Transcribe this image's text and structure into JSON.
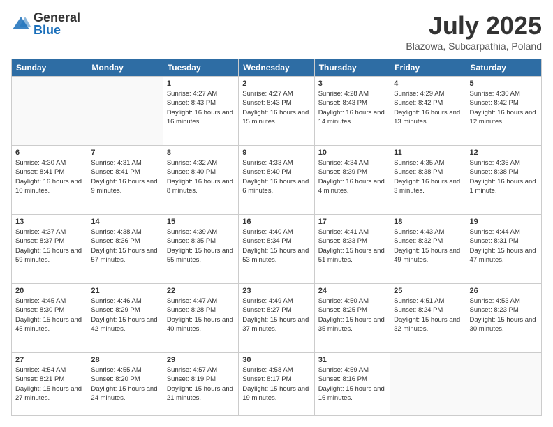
{
  "logo": {
    "general": "General",
    "blue": "Blue"
  },
  "header": {
    "month": "July 2025",
    "location": "Blazowa, Subcarpathia, Poland"
  },
  "weekdays": [
    "Sunday",
    "Monday",
    "Tuesday",
    "Wednesday",
    "Thursday",
    "Friday",
    "Saturday"
  ],
  "weeks": [
    [
      {
        "day": "",
        "sunrise": "",
        "sunset": "",
        "daylight": ""
      },
      {
        "day": "",
        "sunrise": "",
        "sunset": "",
        "daylight": ""
      },
      {
        "day": "1",
        "sunrise": "Sunrise: 4:27 AM",
        "sunset": "Sunset: 8:43 PM",
        "daylight": "Daylight: 16 hours and 16 minutes."
      },
      {
        "day": "2",
        "sunrise": "Sunrise: 4:27 AM",
        "sunset": "Sunset: 8:43 PM",
        "daylight": "Daylight: 16 hours and 15 minutes."
      },
      {
        "day": "3",
        "sunrise": "Sunrise: 4:28 AM",
        "sunset": "Sunset: 8:43 PM",
        "daylight": "Daylight: 16 hours and 14 minutes."
      },
      {
        "day": "4",
        "sunrise": "Sunrise: 4:29 AM",
        "sunset": "Sunset: 8:42 PM",
        "daylight": "Daylight: 16 hours and 13 minutes."
      },
      {
        "day": "5",
        "sunrise": "Sunrise: 4:30 AM",
        "sunset": "Sunset: 8:42 PM",
        "daylight": "Daylight: 16 hours and 12 minutes."
      }
    ],
    [
      {
        "day": "6",
        "sunrise": "Sunrise: 4:30 AM",
        "sunset": "Sunset: 8:41 PM",
        "daylight": "Daylight: 16 hours and 10 minutes."
      },
      {
        "day": "7",
        "sunrise": "Sunrise: 4:31 AM",
        "sunset": "Sunset: 8:41 PM",
        "daylight": "Daylight: 16 hours and 9 minutes."
      },
      {
        "day": "8",
        "sunrise": "Sunrise: 4:32 AM",
        "sunset": "Sunset: 8:40 PM",
        "daylight": "Daylight: 16 hours and 8 minutes."
      },
      {
        "day": "9",
        "sunrise": "Sunrise: 4:33 AM",
        "sunset": "Sunset: 8:40 PM",
        "daylight": "Daylight: 16 hours and 6 minutes."
      },
      {
        "day": "10",
        "sunrise": "Sunrise: 4:34 AM",
        "sunset": "Sunset: 8:39 PM",
        "daylight": "Daylight: 16 hours and 4 minutes."
      },
      {
        "day": "11",
        "sunrise": "Sunrise: 4:35 AM",
        "sunset": "Sunset: 8:38 PM",
        "daylight": "Daylight: 16 hours and 3 minutes."
      },
      {
        "day": "12",
        "sunrise": "Sunrise: 4:36 AM",
        "sunset": "Sunset: 8:38 PM",
        "daylight": "Daylight: 16 hours and 1 minute."
      }
    ],
    [
      {
        "day": "13",
        "sunrise": "Sunrise: 4:37 AM",
        "sunset": "Sunset: 8:37 PM",
        "daylight": "Daylight: 15 hours and 59 minutes."
      },
      {
        "day": "14",
        "sunrise": "Sunrise: 4:38 AM",
        "sunset": "Sunset: 8:36 PM",
        "daylight": "Daylight: 15 hours and 57 minutes."
      },
      {
        "day": "15",
        "sunrise": "Sunrise: 4:39 AM",
        "sunset": "Sunset: 8:35 PM",
        "daylight": "Daylight: 15 hours and 55 minutes."
      },
      {
        "day": "16",
        "sunrise": "Sunrise: 4:40 AM",
        "sunset": "Sunset: 8:34 PM",
        "daylight": "Daylight: 15 hours and 53 minutes."
      },
      {
        "day": "17",
        "sunrise": "Sunrise: 4:41 AM",
        "sunset": "Sunset: 8:33 PM",
        "daylight": "Daylight: 15 hours and 51 minutes."
      },
      {
        "day": "18",
        "sunrise": "Sunrise: 4:43 AM",
        "sunset": "Sunset: 8:32 PM",
        "daylight": "Daylight: 15 hours and 49 minutes."
      },
      {
        "day": "19",
        "sunrise": "Sunrise: 4:44 AM",
        "sunset": "Sunset: 8:31 PM",
        "daylight": "Daylight: 15 hours and 47 minutes."
      }
    ],
    [
      {
        "day": "20",
        "sunrise": "Sunrise: 4:45 AM",
        "sunset": "Sunset: 8:30 PM",
        "daylight": "Daylight: 15 hours and 45 minutes."
      },
      {
        "day": "21",
        "sunrise": "Sunrise: 4:46 AM",
        "sunset": "Sunset: 8:29 PM",
        "daylight": "Daylight: 15 hours and 42 minutes."
      },
      {
        "day": "22",
        "sunrise": "Sunrise: 4:47 AM",
        "sunset": "Sunset: 8:28 PM",
        "daylight": "Daylight: 15 hours and 40 minutes."
      },
      {
        "day": "23",
        "sunrise": "Sunrise: 4:49 AM",
        "sunset": "Sunset: 8:27 PM",
        "daylight": "Daylight: 15 hours and 37 minutes."
      },
      {
        "day": "24",
        "sunrise": "Sunrise: 4:50 AM",
        "sunset": "Sunset: 8:25 PM",
        "daylight": "Daylight: 15 hours and 35 minutes."
      },
      {
        "day": "25",
        "sunrise": "Sunrise: 4:51 AM",
        "sunset": "Sunset: 8:24 PM",
        "daylight": "Daylight: 15 hours and 32 minutes."
      },
      {
        "day": "26",
        "sunrise": "Sunrise: 4:53 AM",
        "sunset": "Sunset: 8:23 PM",
        "daylight": "Daylight: 15 hours and 30 minutes."
      }
    ],
    [
      {
        "day": "27",
        "sunrise": "Sunrise: 4:54 AM",
        "sunset": "Sunset: 8:21 PM",
        "daylight": "Daylight: 15 hours and 27 minutes."
      },
      {
        "day": "28",
        "sunrise": "Sunrise: 4:55 AM",
        "sunset": "Sunset: 8:20 PM",
        "daylight": "Daylight: 15 hours and 24 minutes."
      },
      {
        "day": "29",
        "sunrise": "Sunrise: 4:57 AM",
        "sunset": "Sunset: 8:19 PM",
        "daylight": "Daylight: 15 hours and 21 minutes."
      },
      {
        "day": "30",
        "sunrise": "Sunrise: 4:58 AM",
        "sunset": "Sunset: 8:17 PM",
        "daylight": "Daylight: 15 hours and 19 minutes."
      },
      {
        "day": "31",
        "sunrise": "Sunrise: 4:59 AM",
        "sunset": "Sunset: 8:16 PM",
        "daylight": "Daylight: 15 hours and 16 minutes."
      },
      {
        "day": "",
        "sunrise": "",
        "sunset": "",
        "daylight": ""
      },
      {
        "day": "",
        "sunrise": "",
        "sunset": "",
        "daylight": ""
      }
    ]
  ]
}
